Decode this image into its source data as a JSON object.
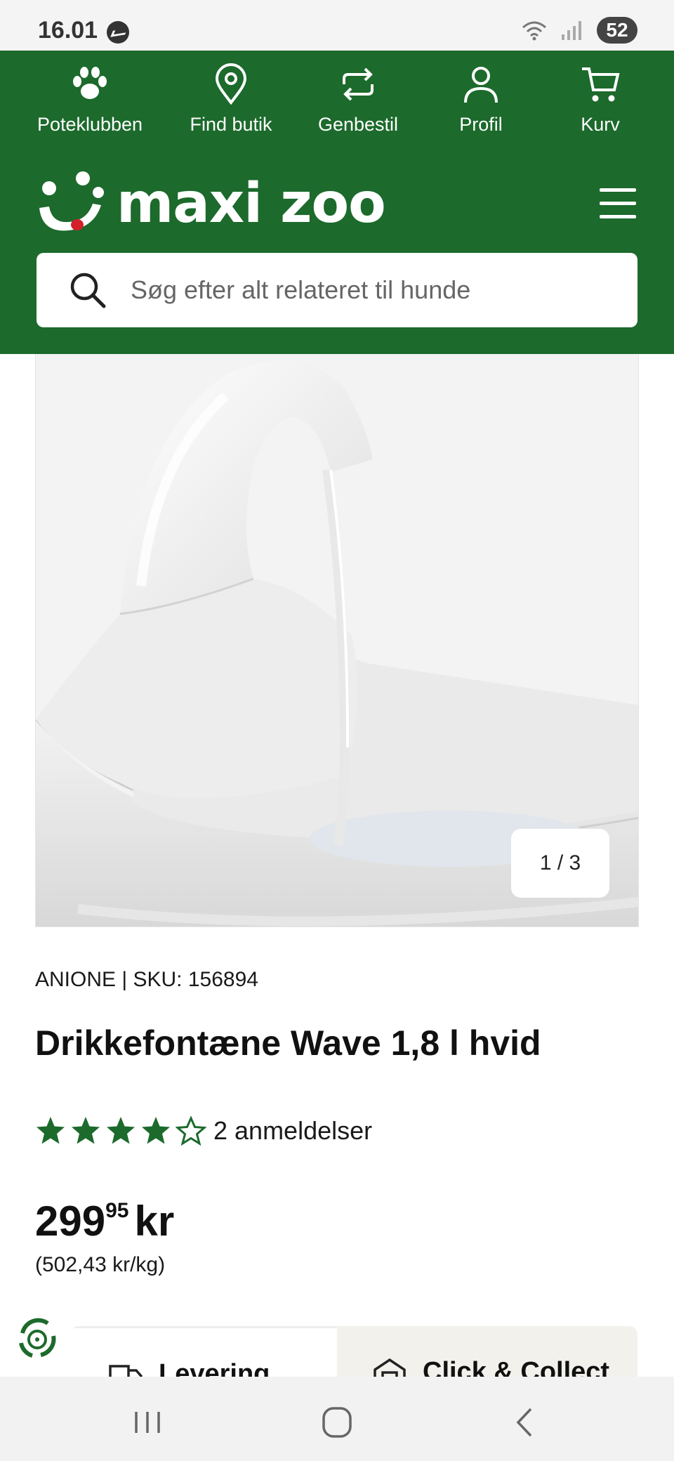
{
  "status_bar": {
    "time": "16.01",
    "battery": "52"
  },
  "topnav": [
    {
      "label": "Poteklubben",
      "icon": "paw-icon"
    },
    {
      "label": "Find butik",
      "icon": "location-pin-icon"
    },
    {
      "label": "Genbestil",
      "icon": "repeat-icon"
    },
    {
      "label": "Profil",
      "icon": "user-icon"
    },
    {
      "label": "Kurv",
      "icon": "cart-icon"
    }
  ],
  "brand": {
    "logo_text": "maxi zoo"
  },
  "search": {
    "placeholder": "Søg efter alt relateret til hunde"
  },
  "gallery": {
    "counter": "1 / 3"
  },
  "product": {
    "brand_sku": "ANIONE | SKU: 156894",
    "title": "Drikkefontæne Wave 1,8 l hvid",
    "rating": 4,
    "rating_max": 5,
    "reviews": "2 anmeldelser",
    "price_int": "299",
    "price_dec": "95",
    "price_currency": "kr",
    "unit_price": "(502,43 kr/kg)"
  },
  "delivery_tabs": {
    "delivery": "Levering",
    "collect": "Click & Collect"
  },
  "colors": {
    "brand_green": "#1c6a2c",
    "star_green": "#1c6a2c"
  }
}
